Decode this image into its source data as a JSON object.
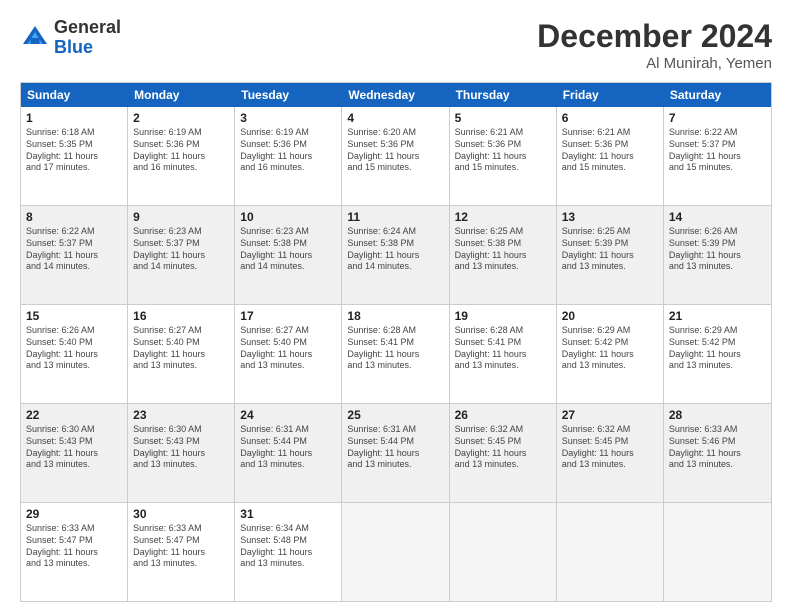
{
  "logo": {
    "general": "General",
    "blue": "Blue"
  },
  "title": "December 2024",
  "location": "Al Munirah, Yemen",
  "days": [
    "Sunday",
    "Monday",
    "Tuesday",
    "Wednesday",
    "Thursday",
    "Friday",
    "Saturday"
  ],
  "weeks": [
    [
      {
        "day": 1,
        "lines": [
          "Sunrise: 6:18 AM",
          "Sunset: 5:35 PM",
          "Daylight: 11 hours",
          "and 17 minutes."
        ]
      },
      {
        "day": 2,
        "lines": [
          "Sunrise: 6:19 AM",
          "Sunset: 5:36 PM",
          "Daylight: 11 hours",
          "and 16 minutes."
        ]
      },
      {
        "day": 3,
        "lines": [
          "Sunrise: 6:19 AM",
          "Sunset: 5:36 PM",
          "Daylight: 11 hours",
          "and 16 minutes."
        ]
      },
      {
        "day": 4,
        "lines": [
          "Sunrise: 6:20 AM",
          "Sunset: 5:36 PM",
          "Daylight: 11 hours",
          "and 15 minutes."
        ]
      },
      {
        "day": 5,
        "lines": [
          "Sunrise: 6:21 AM",
          "Sunset: 5:36 PM",
          "Daylight: 11 hours",
          "and 15 minutes."
        ]
      },
      {
        "day": 6,
        "lines": [
          "Sunrise: 6:21 AM",
          "Sunset: 5:36 PM",
          "Daylight: 11 hours",
          "and 15 minutes."
        ]
      },
      {
        "day": 7,
        "lines": [
          "Sunrise: 6:22 AM",
          "Sunset: 5:37 PM",
          "Daylight: 11 hours",
          "and 15 minutes."
        ]
      }
    ],
    [
      {
        "day": 8,
        "lines": [
          "Sunrise: 6:22 AM",
          "Sunset: 5:37 PM",
          "Daylight: 11 hours",
          "and 14 minutes."
        ]
      },
      {
        "day": 9,
        "lines": [
          "Sunrise: 6:23 AM",
          "Sunset: 5:37 PM",
          "Daylight: 11 hours",
          "and 14 minutes."
        ]
      },
      {
        "day": 10,
        "lines": [
          "Sunrise: 6:23 AM",
          "Sunset: 5:38 PM",
          "Daylight: 11 hours",
          "and 14 minutes."
        ]
      },
      {
        "day": 11,
        "lines": [
          "Sunrise: 6:24 AM",
          "Sunset: 5:38 PM",
          "Daylight: 11 hours",
          "and 14 minutes."
        ]
      },
      {
        "day": 12,
        "lines": [
          "Sunrise: 6:25 AM",
          "Sunset: 5:38 PM",
          "Daylight: 11 hours",
          "and 13 minutes."
        ]
      },
      {
        "day": 13,
        "lines": [
          "Sunrise: 6:25 AM",
          "Sunset: 5:39 PM",
          "Daylight: 11 hours",
          "and 13 minutes."
        ]
      },
      {
        "day": 14,
        "lines": [
          "Sunrise: 6:26 AM",
          "Sunset: 5:39 PM",
          "Daylight: 11 hours",
          "and 13 minutes."
        ]
      }
    ],
    [
      {
        "day": 15,
        "lines": [
          "Sunrise: 6:26 AM",
          "Sunset: 5:40 PM",
          "Daylight: 11 hours",
          "and 13 minutes."
        ]
      },
      {
        "day": 16,
        "lines": [
          "Sunrise: 6:27 AM",
          "Sunset: 5:40 PM",
          "Daylight: 11 hours",
          "and 13 minutes."
        ]
      },
      {
        "day": 17,
        "lines": [
          "Sunrise: 6:27 AM",
          "Sunset: 5:40 PM",
          "Daylight: 11 hours",
          "and 13 minutes."
        ]
      },
      {
        "day": 18,
        "lines": [
          "Sunrise: 6:28 AM",
          "Sunset: 5:41 PM",
          "Daylight: 11 hours",
          "and 13 minutes."
        ]
      },
      {
        "day": 19,
        "lines": [
          "Sunrise: 6:28 AM",
          "Sunset: 5:41 PM",
          "Daylight: 11 hours",
          "and 13 minutes."
        ]
      },
      {
        "day": 20,
        "lines": [
          "Sunrise: 6:29 AM",
          "Sunset: 5:42 PM",
          "Daylight: 11 hours",
          "and 13 minutes."
        ]
      },
      {
        "day": 21,
        "lines": [
          "Sunrise: 6:29 AM",
          "Sunset: 5:42 PM",
          "Daylight: 11 hours",
          "and 13 minutes."
        ]
      }
    ],
    [
      {
        "day": 22,
        "lines": [
          "Sunrise: 6:30 AM",
          "Sunset: 5:43 PM",
          "Daylight: 11 hours",
          "and 13 minutes."
        ]
      },
      {
        "day": 23,
        "lines": [
          "Sunrise: 6:30 AM",
          "Sunset: 5:43 PM",
          "Daylight: 11 hours",
          "and 13 minutes."
        ]
      },
      {
        "day": 24,
        "lines": [
          "Sunrise: 6:31 AM",
          "Sunset: 5:44 PM",
          "Daylight: 11 hours",
          "and 13 minutes."
        ]
      },
      {
        "day": 25,
        "lines": [
          "Sunrise: 6:31 AM",
          "Sunset: 5:44 PM",
          "Daylight: 11 hours",
          "and 13 minutes."
        ]
      },
      {
        "day": 26,
        "lines": [
          "Sunrise: 6:32 AM",
          "Sunset: 5:45 PM",
          "Daylight: 11 hours",
          "and 13 minutes."
        ]
      },
      {
        "day": 27,
        "lines": [
          "Sunrise: 6:32 AM",
          "Sunset: 5:45 PM",
          "Daylight: 11 hours",
          "and 13 minutes."
        ]
      },
      {
        "day": 28,
        "lines": [
          "Sunrise: 6:33 AM",
          "Sunset: 5:46 PM",
          "Daylight: 11 hours",
          "and 13 minutes."
        ]
      }
    ],
    [
      {
        "day": 29,
        "lines": [
          "Sunrise: 6:33 AM",
          "Sunset: 5:47 PM",
          "Daylight: 11 hours",
          "and 13 minutes."
        ]
      },
      {
        "day": 30,
        "lines": [
          "Sunrise: 6:33 AM",
          "Sunset: 5:47 PM",
          "Daylight: 11 hours",
          "and 13 minutes."
        ]
      },
      {
        "day": 31,
        "lines": [
          "Sunrise: 6:34 AM",
          "Sunset: 5:48 PM",
          "Daylight: 11 hours",
          "and 13 minutes."
        ]
      },
      null,
      null,
      null,
      null
    ]
  ]
}
